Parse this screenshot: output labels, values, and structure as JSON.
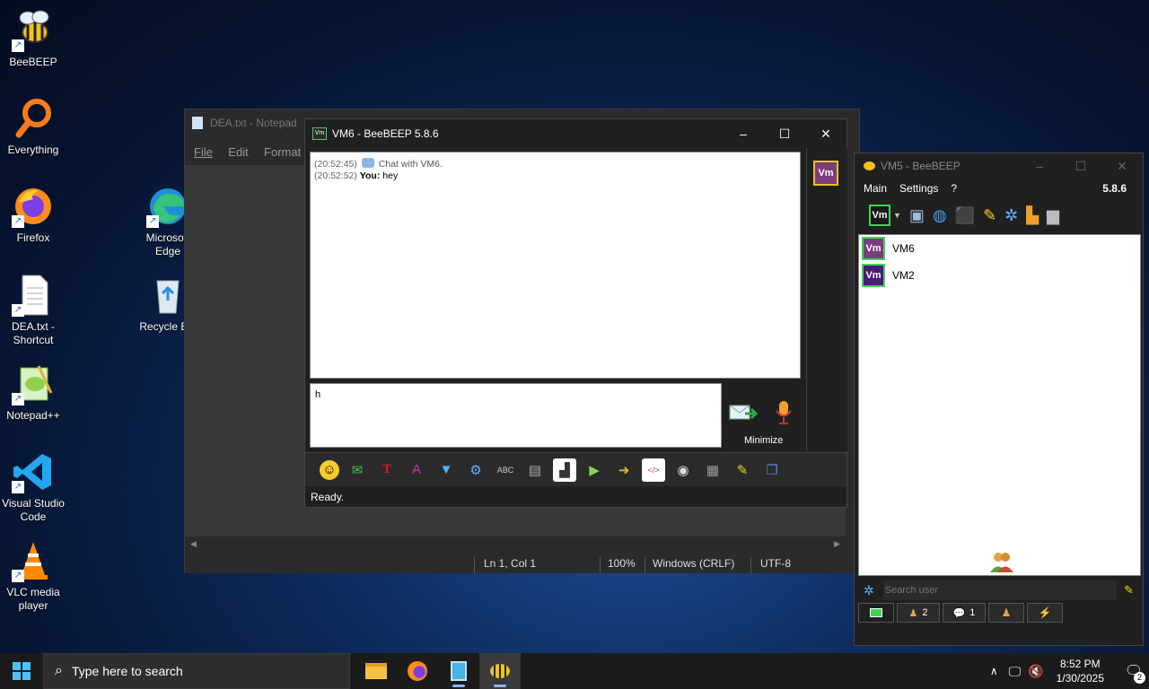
{
  "desktop": {
    "icons": [
      {
        "label": "BeeBEEP"
      },
      {
        "label": "Everything"
      },
      {
        "label": "Firefox"
      },
      {
        "label": "DEA.txt - Shortcut"
      },
      {
        "label": "Notepad++"
      },
      {
        "label": "Visual Studio Code"
      },
      {
        "label": "VLC media player"
      },
      {
        "label": "Microsoft Edge"
      },
      {
        "label": "Recycle Bin"
      }
    ]
  },
  "notepad": {
    "title": "DEA.txt - Notepad",
    "menu": [
      "File",
      "Edit",
      "Format"
    ],
    "status": {
      "position": "Ln 1, Col 1",
      "zoom": "100%",
      "line_ending": "Windows (CRLF)",
      "encoding": "UTF-8"
    }
  },
  "chat_window": {
    "title": "VM6 - BeeBEEP 5.8.6",
    "messages": [
      {
        "time": "(20:52:45)",
        "sender": "",
        "text": "Chat with VM6."
      },
      {
        "time": "(20:52:52)",
        "sender": "You:",
        "text": "hey"
      }
    ],
    "input_value": "h",
    "minimize_label": "Minimize",
    "status": "Ready.",
    "user_badge": "Vm"
  },
  "vm5_window": {
    "title": "VM5 - BeeBEEP",
    "menu": [
      "Main",
      "Settings",
      "?"
    ],
    "version": "5.8.6",
    "users": [
      {
        "badge": "Vm",
        "name": "VM6",
        "color": "#7b3d7e"
      },
      {
        "badge": "Vm",
        "name": "VM2",
        "color": "#4b1a7a"
      }
    ],
    "search_placeholder": "Search user",
    "tabs": [
      {
        "count": ""
      },
      {
        "count": "2"
      },
      {
        "count": "1"
      },
      {
        "count": ""
      },
      {
        "count": ""
      }
    ]
  },
  "taskbar": {
    "search_placeholder": "Type here to search",
    "time": "8:52 PM",
    "date": "1/30/2025",
    "notification_count": "2"
  }
}
